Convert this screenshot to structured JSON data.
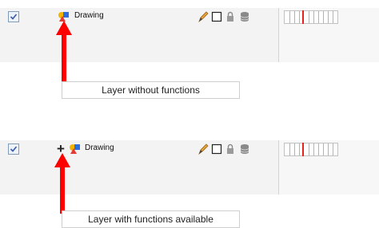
{
  "panels": [
    {
      "layer_name": "Drawing",
      "has_functions": false,
      "checked": true,
      "callout": "Layer without functions"
    },
    {
      "layer_name": "Drawing",
      "has_functions": true,
      "expand_icon": "+",
      "checked": true,
      "callout": "Layer with functions available"
    }
  ],
  "icons": {
    "checkbox": "checkmark-icon",
    "layer": "drawing-layer-icon",
    "pencil": "pencil-icon",
    "square": "outline-square-icon",
    "lock": "lock-icon",
    "stack": "database-stack-icon"
  },
  "colors": {
    "arrow": "#ff0000",
    "playhead": "#e8231b"
  }
}
